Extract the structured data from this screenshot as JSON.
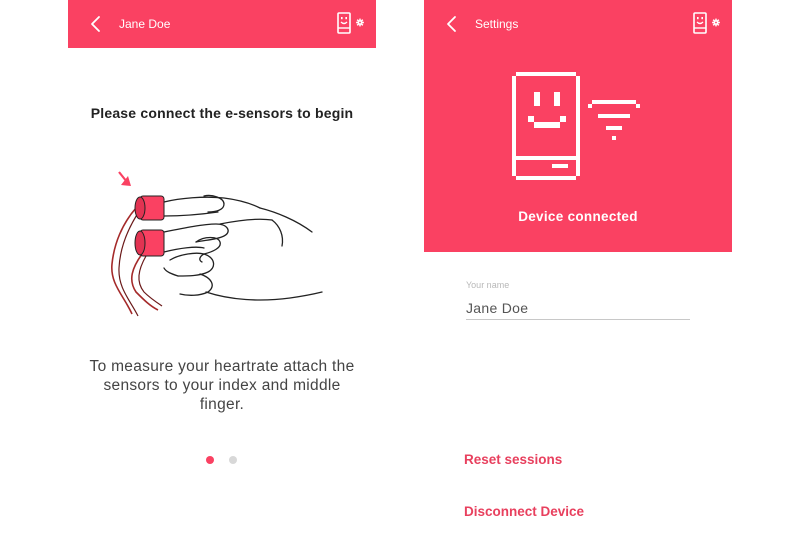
{
  "screen_left": {
    "header": {
      "title": "Jane Doe"
    },
    "prompt": "Please connect the e-sensors to begin",
    "instructions": "To measure your heartrate attach the sensors to your index and middle finger.",
    "pager": {
      "total_pages": 2,
      "current_page": 1
    }
  },
  "screen_right": {
    "header": {
      "title": "Settings"
    },
    "status": "Device connected",
    "name_field": {
      "label": "Your name",
      "value": "Jane Doe"
    },
    "actions": {
      "reset": "Reset sessions",
      "disconnect": "Disconnect Device"
    }
  },
  "colors": {
    "accent": "#fa4162",
    "link": "#e8405e",
    "pager_inactive": "#d8d8d8"
  }
}
